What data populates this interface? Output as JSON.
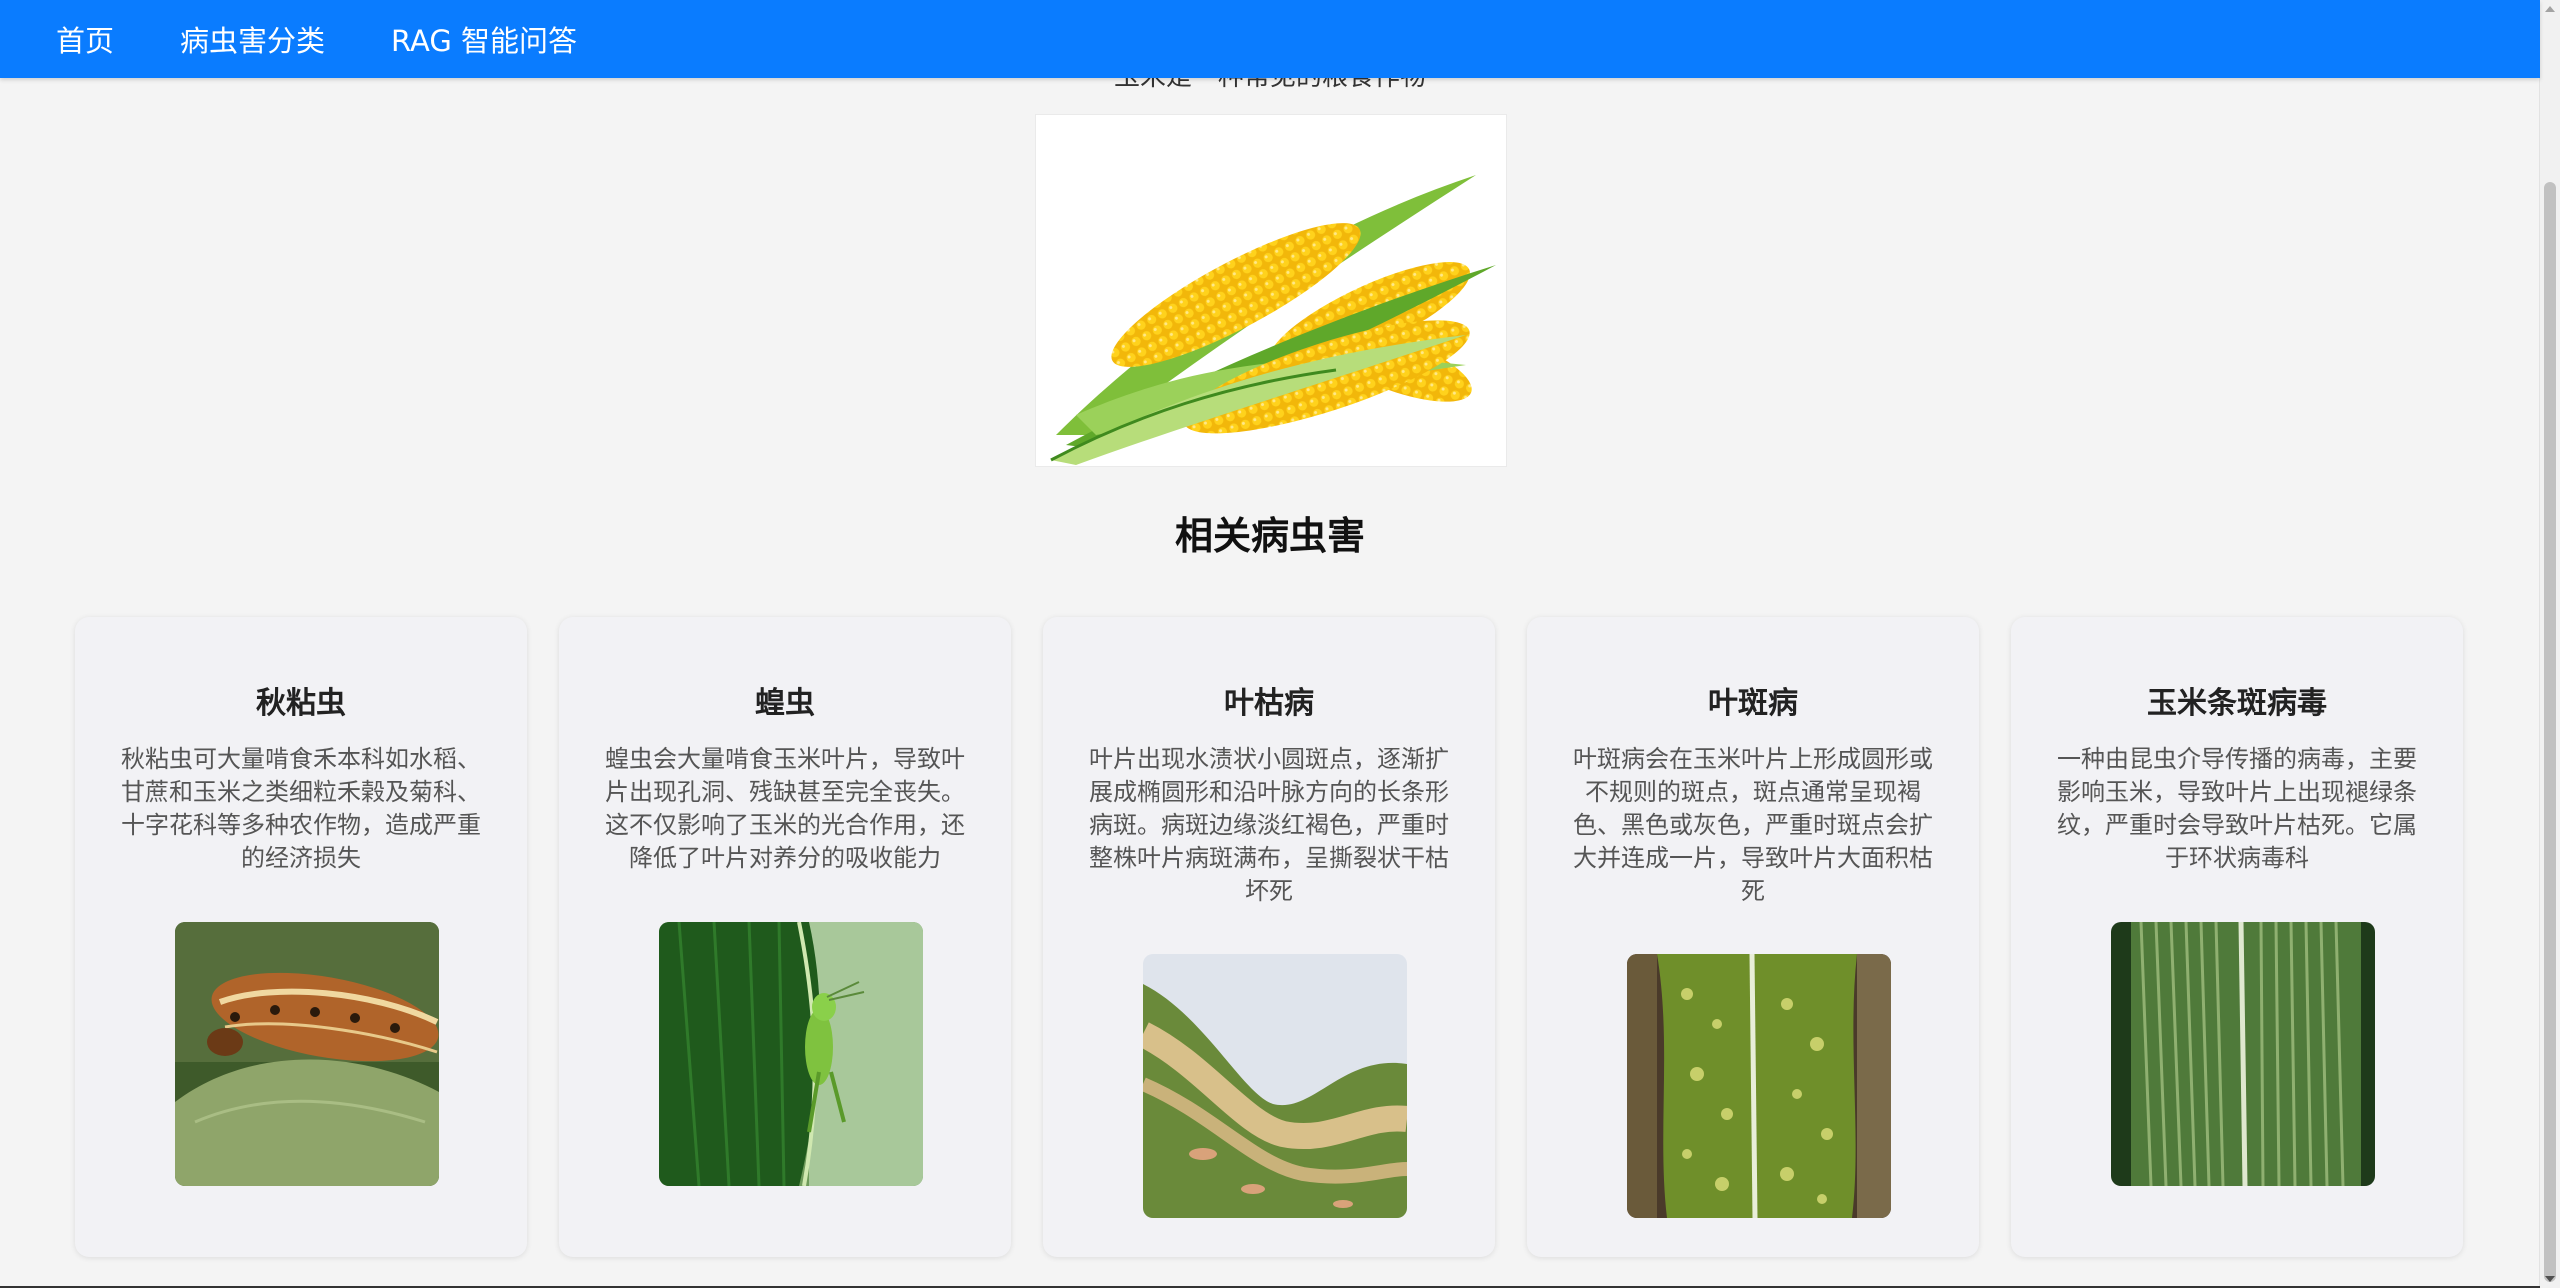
{
  "nav": {
    "items": [
      {
        "label": "首页"
      },
      {
        "label": "病虫害分类"
      },
      {
        "label": "RAG 智能问答"
      }
    ],
    "background": "#0a7cff"
  },
  "intro": {
    "text": "玉米是一种常见的粮食作物"
  },
  "section": {
    "title": "相关病虫害"
  },
  "cards": [
    {
      "title": "秋粘虫",
      "desc": "秋粘虫可大量啃食禾本科如水稻、甘蔗和玉米之类细粒禾榖及菊科、十字花科等多种农作物，造成严重的经济损失",
      "icon": "armyworm-image"
    },
    {
      "title": "蝗虫",
      "desc": "蝗虫会大量啃食玉米叶片，导致叶片出现孔洞、残缺甚至完全丧失。这不仅影响了玉米的光合作用，还降低了叶片对养分的吸收能力",
      "icon": "locust-image"
    },
    {
      "title": "叶枯病",
      "desc": "叶片出现水渍状小圆斑点，逐渐扩展成椭圆形和沿叶脉方向的长条形病斑。病斑边缘淡红褐色，严重时整株叶片病斑满布，呈撕裂状干枯坏死",
      "icon": "leaf-blight-image"
    },
    {
      "title": "叶斑病",
      "desc": "叶斑病会在玉米叶片上形成圆形或不规则的斑点，斑点通常呈现褐色、黑色或灰色，严重时斑点会扩大并连成一片，导致叶片大面积枯死",
      "icon": "leaf-spot-image"
    },
    {
      "title": "玉米条斑病毒",
      "desc": "一种由昆虫介导传播的病毒，主要影响玉米，导致叶片上出现褪绿条纹，严重时会导致叶片枯死。它属于环状病毒科",
      "icon": "maize-streak-virus-image"
    }
  ]
}
